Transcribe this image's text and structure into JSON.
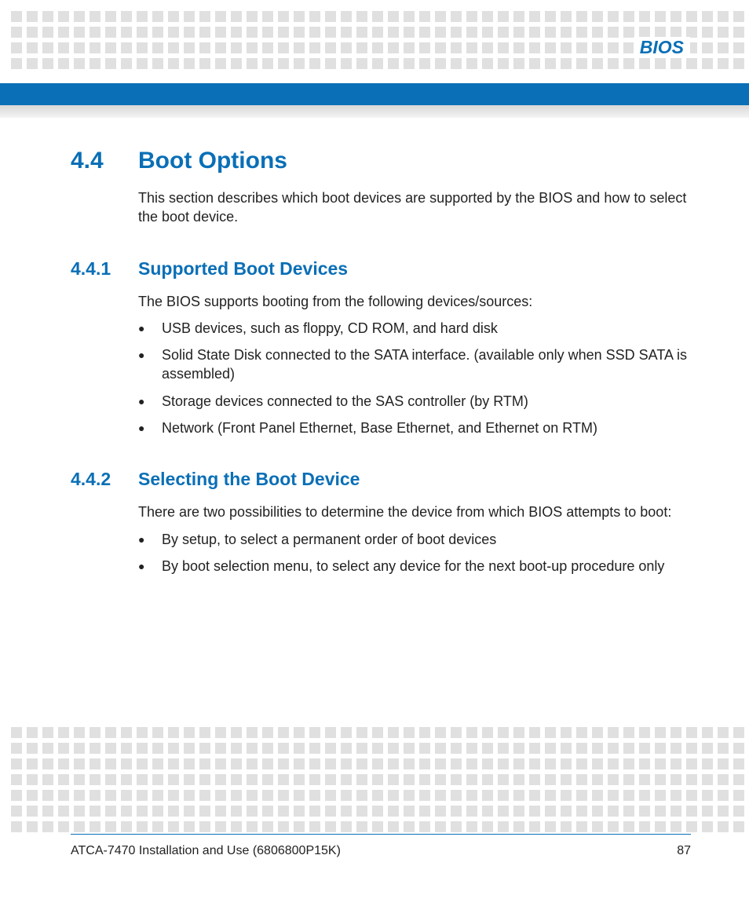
{
  "header": {
    "chapter_label": "BIOS"
  },
  "section": {
    "number": "4.4",
    "title": "Boot Options",
    "intro": "This section describes which boot devices are supported by the BIOS and how to select the boot device."
  },
  "sub1": {
    "number": "4.4.1",
    "title": "Supported Boot Devices",
    "intro": "The BIOS supports booting from the following devices/sources:",
    "items": [
      "USB devices, such as floppy, CD ROM, and hard disk",
      "Solid State Disk connected to the SATA interface. (available only when SSD SATA is assembled)",
      "Storage devices connected to the SAS controller (by RTM)",
      "Network (Front Panel Ethernet, Base Ethernet, and Ethernet on RTM)"
    ]
  },
  "sub2": {
    "number": "4.4.2",
    "title": "Selecting the Boot Device",
    "intro": "There are two possibilities to determine the device from which BIOS attempts to boot:",
    "items": [
      "By setup, to select a permanent order of boot devices",
      "By boot selection menu, to select any device for the next boot-up procedure only"
    ]
  },
  "footer": {
    "doc_title": "ATCA-7470 Installation and Use (6806800P15K)",
    "page": "87"
  }
}
